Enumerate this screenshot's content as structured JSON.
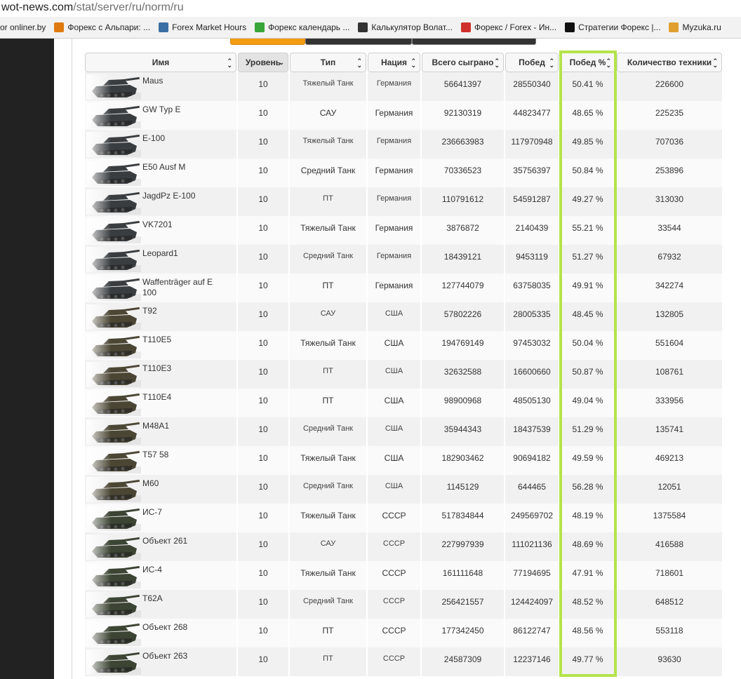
{
  "browser": {
    "url_host": "wot-news.com",
    "url_path": "/stat/server/ru/norm/ru"
  },
  "bookmarks": [
    {
      "label": "or onliner.by",
      "icon": "onliner-icon",
      "color": "#ffffff"
    },
    {
      "label": "Форекс с Альпари: ...",
      "icon": "ribbon-icon",
      "color": "#e07a10"
    },
    {
      "label": "Forex Market Hours",
      "icon": "globe-icon",
      "color": "#3a6ea5"
    },
    {
      "label": "Форекс календарь ...",
      "icon": "calendar-icon",
      "color": "#3aa53a"
    },
    {
      "label": "Калькулятор Волат...",
      "icon": "inv-icon",
      "color": "#333333"
    },
    {
      "label": "Форекс / Forex - Ин...",
      "icon": "gear-icon",
      "color": "#d0302b"
    },
    {
      "label": "Стратегии Форекс |...",
      "icon": "bull-icon",
      "color": "#111111"
    },
    {
      "label": "Myzuka.ru",
      "icon": "music-icon",
      "color": "#e0a030"
    }
  ],
  "table": {
    "columns": [
      {
        "label": "Имя",
        "key": "name"
      },
      {
        "label": "Уровень",
        "key": "level"
      },
      {
        "label": "Тип",
        "key": "type"
      },
      {
        "label": "Нация",
        "key": "nation"
      },
      {
        "label": "Всего сыграно",
        "key": "total"
      },
      {
        "label": "Побед",
        "key": "wins"
      },
      {
        "label": "Побед %",
        "key": "winrate"
      },
      {
        "label": "Количество техники",
        "key": "count"
      }
    ],
    "rows": [
      {
        "name": "Maus",
        "level": "10",
        "type": "Тяжелый Танк",
        "nation": "Германия",
        "total": "56641397",
        "wins": "28550340",
        "winrate": "50.41 %",
        "count": "226600"
      },
      {
        "name": "GW Typ E",
        "level": "10",
        "type": "САУ",
        "nation": "Германия",
        "total": "92130319",
        "wins": "44823477",
        "winrate": "48.65 %",
        "count": "225235"
      },
      {
        "name": "E-100",
        "level": "10",
        "type": "Тяжелый Танк",
        "nation": "Германия",
        "total": "236663983",
        "wins": "117970948",
        "winrate": "49.85 %",
        "count": "707036"
      },
      {
        "name": "E50 Ausf M",
        "level": "10",
        "type": "Средний Танк",
        "nation": "Германия",
        "total": "70336523",
        "wins": "35756397",
        "winrate": "50.84 %",
        "count": "253896"
      },
      {
        "name": "JagdPz E-100",
        "level": "10",
        "type": "ПТ",
        "nation": "Германия",
        "total": "110791612",
        "wins": "54591287",
        "winrate": "49.27 %",
        "count": "313030"
      },
      {
        "name": "VK7201",
        "level": "10",
        "type": "Тяжелый Танк",
        "nation": "Германия",
        "total": "3876872",
        "wins": "2140439",
        "winrate": "55.21 %",
        "count": "33544"
      },
      {
        "name": "Leopard1",
        "level": "10",
        "type": "Средний Танк",
        "nation": "Германия",
        "total": "18439121",
        "wins": "9453119",
        "winrate": "51.27 %",
        "count": "67932"
      },
      {
        "name": "Waffenträger auf E 100",
        "level": "10",
        "type": "ПТ",
        "nation": "Германия",
        "total": "127744079",
        "wins": "63758035",
        "winrate": "49.91 %",
        "count": "342274"
      },
      {
        "name": "T92",
        "level": "10",
        "type": "САУ",
        "nation": "США",
        "total": "57802226",
        "wins": "28005335",
        "winrate": "48.45 %",
        "count": "132805"
      },
      {
        "name": "T110E5",
        "level": "10",
        "type": "Тяжелый Танк",
        "nation": "США",
        "total": "194769149",
        "wins": "97453032",
        "winrate": "50.04 %",
        "count": "551604"
      },
      {
        "name": "T110E3",
        "level": "10",
        "type": "ПТ",
        "nation": "США",
        "total": "32632588",
        "wins": "16600660",
        "winrate": "50.87 %",
        "count": "108761"
      },
      {
        "name": "T110E4",
        "level": "10",
        "type": "ПТ",
        "nation": "США",
        "total": "98900968",
        "wins": "48505130",
        "winrate": "49.04 %",
        "count": "333956"
      },
      {
        "name": "M48A1",
        "level": "10",
        "type": "Средний Танк",
        "nation": "США",
        "total": "35944343",
        "wins": "18437539",
        "winrate": "51.29 %",
        "count": "135741"
      },
      {
        "name": "T57 58",
        "level": "10",
        "type": "Тяжелый Танк",
        "nation": "США",
        "total": "182903462",
        "wins": "90694182",
        "winrate": "49.59 %",
        "count": "469213"
      },
      {
        "name": "M60",
        "level": "10",
        "type": "Средний Танк",
        "nation": "США",
        "total": "1145129",
        "wins": "644465",
        "winrate": "56.28 %",
        "count": "12051"
      },
      {
        "name": "ИС-7",
        "level": "10",
        "type": "Тяжелый Танк",
        "nation": "СССР",
        "total": "517834844",
        "wins": "249569702",
        "winrate": "48.19 %",
        "count": "1375584"
      },
      {
        "name": "Объект 261",
        "level": "10",
        "type": "САУ",
        "nation": "СССР",
        "total": "227997939",
        "wins": "111021136",
        "winrate": "48.69 %",
        "count": "416588"
      },
      {
        "name": "ИС-4",
        "level": "10",
        "type": "Тяжелый Танк",
        "nation": "СССР",
        "total": "161111648",
        "wins": "77194695",
        "winrate": "47.91 %",
        "count": "718601"
      },
      {
        "name": "T62A",
        "level": "10",
        "type": "Средний Танк",
        "nation": "СССР",
        "total": "256421557",
        "wins": "124424097",
        "winrate": "48.52 %",
        "count": "648512"
      },
      {
        "name": "Объект 268",
        "level": "10",
        "type": "ПТ",
        "nation": "СССР",
        "total": "177342450",
        "wins": "86122747",
        "winrate": "48.56 %",
        "count": "553118"
      },
      {
        "name": "Объект 263",
        "level": "10",
        "type": "ПТ",
        "nation": "СССР",
        "total": "24587309",
        "wins": "12237146",
        "winrate": "49.77 %",
        "count": "93630"
      }
    ]
  },
  "colors": {
    "highlight": "#b5e34b",
    "active_tab": "#f39c12",
    "germany_tank": "#3a3d40",
    "usa_tank": "#4b4634",
    "ussr_tank": "#3c4433"
  }
}
